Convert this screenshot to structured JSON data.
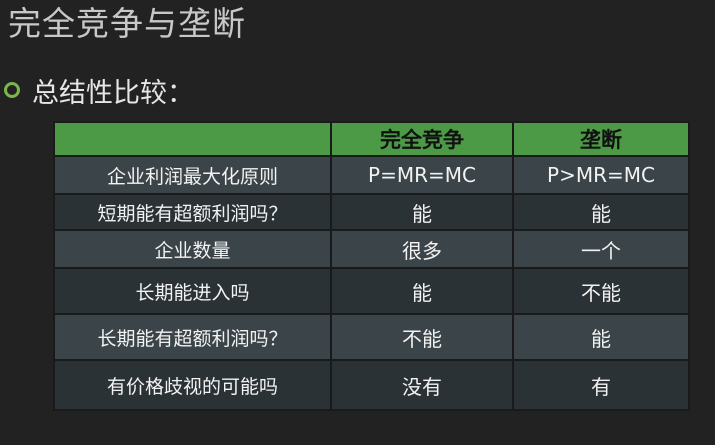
{
  "title": "完全竞争与垄断",
  "bullet": "总结性比较：",
  "table": {
    "headers": [
      "",
      "完全竞争",
      "垄断"
    ],
    "rows": [
      {
        "label": "企业利润最大化原则",
        "competitive": "P=MR=MC",
        "monopoly": "P>MR=MC"
      },
      {
        "label": "短期能有超额利润吗？",
        "competitive": "能",
        "monopoly": "能"
      },
      {
        "label": "企业数量",
        "competitive": "很多",
        "monopoly": "一个"
      },
      {
        "label": "长期能进入吗",
        "competitive": "能",
        "monopoly": "不能"
      },
      {
        "label": "长期能有超额利润吗？",
        "competitive": "不能",
        "monopoly": "能"
      },
      {
        "label": "有价格歧视的可能吗",
        "competitive": "没有",
        "monopoly": "有"
      }
    ]
  },
  "colors": {
    "background": "#222222",
    "header_green": "#4c9a46",
    "bullet_green": "#7ab648",
    "row_light": "#3b4448",
    "row_dark": "#2b3236"
  },
  "icons": {
    "bullet": "ring-bullet-icon"
  }
}
